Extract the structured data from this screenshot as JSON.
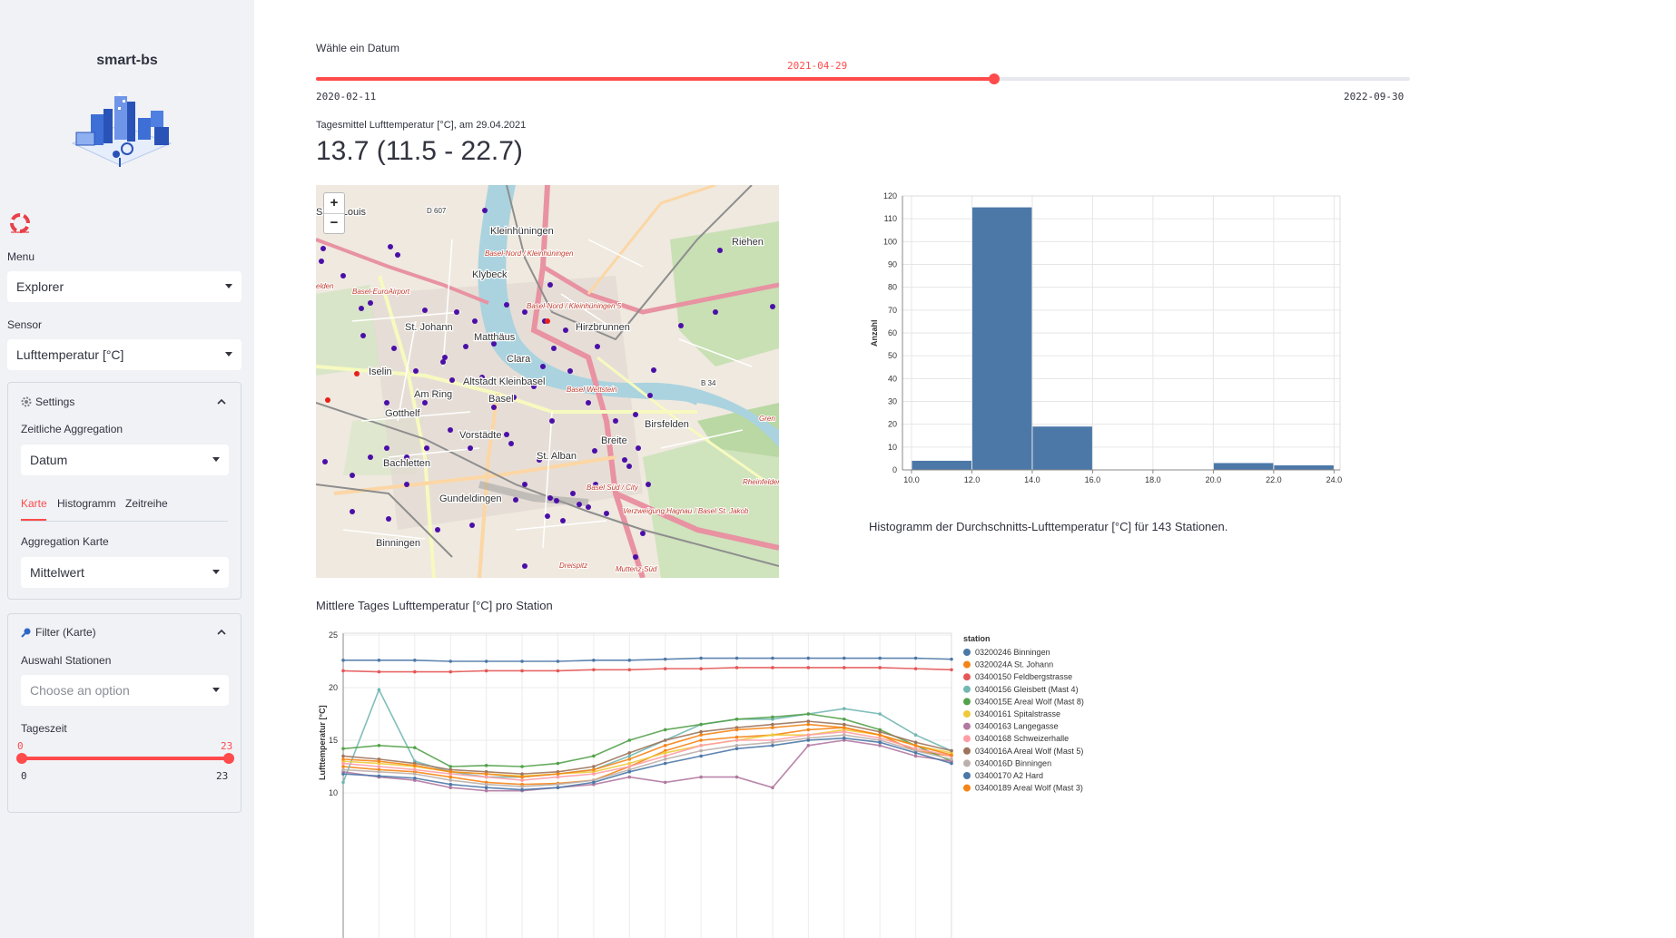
{
  "sidebar": {
    "app_title": "smart-bs",
    "menu_label": "Menu",
    "menu_value": "Explorer",
    "sensor_label": "Sensor",
    "sensor_value": "Lufttemperatur [°C]",
    "settings": {
      "title": "Settings",
      "aggregation_label": "Zeitliche Aggregation",
      "aggregation_value": "Datum",
      "tabs": [
        "Karte",
        "Histogramm",
        "Zeitreihe"
      ],
      "map_aggregation_label": "Aggregation Karte",
      "map_aggregation_value": "Mittelwert"
    },
    "filter": {
      "title": "Filter (Karte)",
      "stations_label": "Auswahl Stationen",
      "stations_placeholder": "Choose an option",
      "daytime_label": "Tageszeit",
      "slider_low": "0",
      "slider_high": "23",
      "slider_min": "0",
      "slider_max": "23"
    }
  },
  "main": {
    "date_slider": {
      "label": "Wähle ein Datum",
      "value": "2021-04-29",
      "min": "2020-02-11",
      "max": "2022-09-30",
      "position": 0.62
    },
    "metric_label": "Tagesmittel Lufttemperatur [°C], am 29.04.2021",
    "metric_value": "13.7 (11.5 - 22.7)",
    "map": {
      "zoom_in": "+",
      "zoom_out": "−",
      "places": [
        "Saint-Louis",
        "Kleinhüningen",
        "Klybeck",
        "Riehen",
        "St. Johann",
        "Matthäus",
        "Hirzbrunnen",
        "Clara",
        "Iselin",
        "Am Ring",
        "Altstadt Kleinbasel",
        "Basel",
        "Gotthelf",
        "Birsfelden",
        "Vorstädte",
        "Breite",
        "St. Alban",
        "Bachletten",
        "Gundeldingen",
        "Binningen",
        "D 607",
        "B 34"
      ],
      "rail_labels": [
        "Basel-Nord / Kleinhüningen",
        "Basel-EuroAirport",
        "Basel-Nord / Kleinhüningen 5",
        "Basel Wettstein",
        "Basel Süd / City",
        "Verzweigung Hagnau / Basel St. Jakob",
        "Muttenz-Süd",
        "Dreispitz",
        "Rheinfelderstrasse",
        "Gren",
        "elden"
      ]
    },
    "histogram_caption": "Histogramm der Durchschnitts-Lufttemperatur [°C] für 143 Stationen.",
    "line_chart_title": "Mittlere Tages Lufttemperatur [°C] pro Station"
  },
  "chart_data": [
    {
      "type": "bar",
      "ylabel": "Anzahl",
      "xlabel": "",
      "x_ticks": [
        "10.0",
        "12.0",
        "14.0",
        "16.0",
        "18.0",
        "20.0",
        "22.0",
        "24.0"
      ],
      "y_ticks": [
        "0",
        "10",
        "20",
        "30",
        "40",
        "50",
        "60",
        "70",
        "80",
        "90",
        "100",
        "110",
        "120"
      ],
      "bins": [
        [
          10,
          12
        ],
        [
          12,
          14
        ],
        [
          14,
          16
        ],
        [
          16,
          18
        ],
        [
          18,
          20
        ],
        [
          20,
          22
        ],
        [
          22,
          24
        ]
      ],
      "values": [
        4,
        115,
        19,
        0,
        0,
        3,
        2
      ],
      "xlim": [
        9.7,
        24.2
      ],
      "ylim": [
        0,
        120
      ],
      "color": "#4c78a8"
    },
    {
      "type": "line",
      "ylabel": "Lufttemperatur [°C]",
      "y_ticks": [
        "10",
        "15",
        "20",
        "25"
      ],
      "ylim": [
        9,
        28
      ],
      "legend_title": "station",
      "legend_position": "right",
      "series": [
        {
          "name": "03200246 Binningen",
          "color": "#4c78a8",
          "values": [
            22.6,
            22.6,
            22.6,
            22.5,
            22.5,
            22.5,
            22.5,
            22.6,
            22.6,
            22.7,
            22.8,
            22.8,
            22.8,
            22.8,
            22.8,
            22.8,
            22.8,
            22.7
          ]
        },
        {
          "name": "0320024A St. Johann",
          "color": "#f58518",
          "values": [
            12.5,
            12.2,
            12.0,
            11.5,
            11.0,
            10.8,
            10.9,
            11.2,
            12.5,
            14.0,
            15.0,
            15.3,
            15.5,
            16.0,
            16.2,
            15.5,
            14.0,
            13.5
          ]
        },
        {
          "name": "03400150 Feldbergstrasse",
          "color": "#e45756",
          "values": [
            21.6,
            21.5,
            21.5,
            21.5,
            21.6,
            21.6,
            21.6,
            21.7,
            21.7,
            21.8,
            21.8,
            21.9,
            21.9,
            21.9,
            21.9,
            21.9,
            21.8,
            21.7
          ]
        },
        {
          "name": "03400156 Gleisbett (Mast 4)",
          "color": "#72b7b2",
          "values": [
            11.0,
            19.8,
            13.0,
            12.0,
            11.5,
            11.5,
            11.8,
            12.2,
            13.5,
            15.0,
            16.5,
            17.0,
            17.0,
            17.5,
            18.0,
            17.5,
            15.5,
            14.0
          ]
        },
        {
          "name": "0340015E Areal Wolf (Mast 8)",
          "color": "#54a24b",
          "values": [
            14.2,
            14.5,
            14.3,
            12.5,
            12.6,
            12.5,
            12.8,
            13.5,
            15.0,
            16.0,
            16.5,
            17.0,
            17.2,
            17.5,
            17.0,
            16.0,
            14.5,
            13.0
          ]
        },
        {
          "name": "03400161 Spitalstrasse",
          "color": "#eeca3b",
          "values": [
            13.0,
            12.8,
            12.5,
            12.0,
            11.8,
            11.6,
            11.8,
            12.0,
            12.8,
            13.8,
            14.5,
            15.0,
            15.5,
            15.5,
            16.0,
            15.5,
            14.5,
            13.8
          ]
        },
        {
          "name": "03400163 Langegasse",
          "color": "#b279a2",
          "values": [
            12.0,
            11.5,
            11.2,
            10.5,
            10.2,
            10.2,
            10.5,
            10.8,
            11.5,
            11.0,
            11.5,
            11.5,
            10.5,
            14.5,
            15.0,
            14.5,
            13.5,
            13.0
          ]
        },
        {
          "name": "03400168 Schweizerhalle",
          "color": "#ff9da6",
          "values": [
            12.8,
            12.5,
            12.2,
            11.8,
            11.5,
            11.2,
            11.5,
            11.8,
            12.5,
            13.5,
            14.5,
            15.0,
            15.0,
            15.5,
            15.8,
            15.2,
            14.2,
            13.5
          ]
        },
        {
          "name": "0340016A Areal Wolf (Mast 5)",
          "color": "#9d755d",
          "values": [
            13.5,
            13.2,
            12.8,
            12.2,
            12.0,
            11.8,
            12.0,
            12.5,
            13.8,
            15.0,
            15.8,
            16.2,
            16.5,
            16.8,
            16.5,
            15.8,
            14.8,
            14.0
          ]
        },
        {
          "name": "0340016D Binningen",
          "color": "#bab0ac",
          "values": [
            12.2,
            12.0,
            11.8,
            11.2,
            10.8,
            10.6,
            10.8,
            11.2,
            12.2,
            13.2,
            14.0,
            14.5,
            14.8,
            15.2,
            15.5,
            15.0,
            14.0,
            13.2
          ]
        },
        {
          "name": "03400170 A2 Hard",
          "color": "#4c78a8",
          "values": [
            11.8,
            11.6,
            11.4,
            10.8,
            10.5,
            10.3,
            10.5,
            11.0,
            12.0,
            12.8,
            13.5,
            14.2,
            14.5,
            15.0,
            15.2,
            14.8,
            13.8,
            12.8
          ]
        },
        {
          "name": "03400189 Areal Wolf (Mast 3)",
          "color": "#f58518",
          "values": [
            13.2,
            13.0,
            12.6,
            12.0,
            11.8,
            11.5,
            11.8,
            12.2,
            13.2,
            14.5,
            15.5,
            16.0,
            16.2,
            16.5,
            16.2,
            15.5,
            14.5,
            13.6
          ]
        }
      ]
    }
  ]
}
